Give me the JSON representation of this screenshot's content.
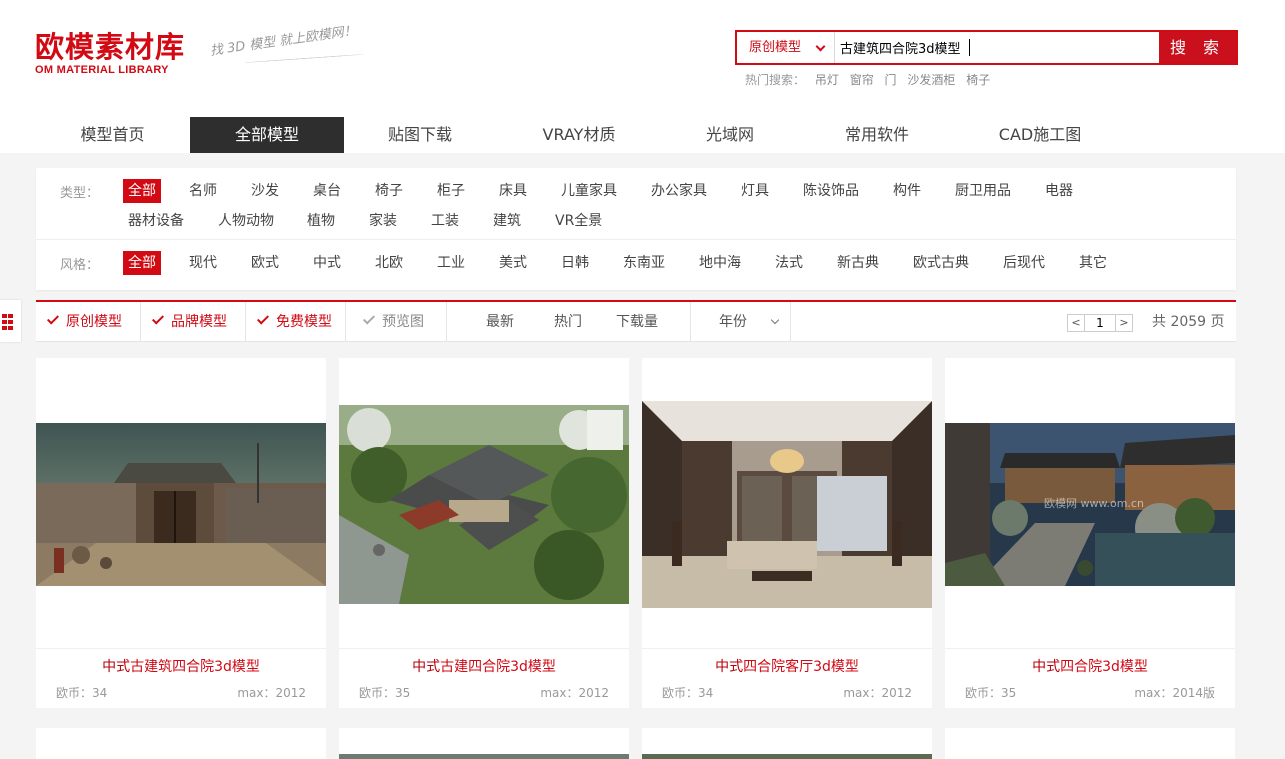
{
  "brand": {
    "logo_main": "欧模素材库",
    "logo_sub": "OM MATERIAL LIBRARY",
    "slogan": "找 3D 模型 就上欧模网！",
    "accent": "#d10a14"
  },
  "search": {
    "type": "原创模型",
    "value": "古建筑四合院3d模型",
    "button": "搜 索"
  },
  "hot": {
    "label": "热门搜索：",
    "items": [
      "吊灯",
      "窗帘",
      "门",
      "沙发酒柜",
      "椅子"
    ]
  },
  "nav": [
    "模型首页",
    "全部模型",
    "贴图下载",
    "VRAY材质",
    "光域网",
    "常用软件",
    "CAD施工图"
  ],
  "filters": {
    "type_label": "类型：",
    "types": [
      "全部",
      "名师",
      "沙发",
      "桌台",
      "椅子",
      "柜子",
      "床具",
      "儿童家具",
      "办公家具",
      "灯具",
      "陈设饰品",
      "构件",
      "厨卫用品",
      "电器",
      "器材设备",
      "人物动物",
      "植物",
      "家装",
      "工装",
      "建筑",
      "VR全景"
    ],
    "style_label": "风格：",
    "styles": [
      "全部",
      "现代",
      "欧式",
      "中式",
      "北欧",
      "工业",
      "美式",
      "日韩",
      "东南亚",
      "地中海",
      "法式",
      "新古典",
      "欧式古典",
      "后现代",
      "其它"
    ]
  },
  "sortbar": {
    "checks": [
      "原创模型",
      "品牌模型",
      "免费模型",
      "预览图"
    ],
    "sorts": [
      "最新",
      "热门",
      "下载量"
    ],
    "year": "年份",
    "page": "1",
    "prev": "<",
    "next": ">",
    "total": "共 2059 页"
  },
  "cards": [
    {
      "title_pre": "中式",
      "title": "古建筑四合院3d模型",
      "coin": "欧币：34",
      "max": "max：2012"
    },
    {
      "title_pre": "中式",
      "title": "古建四合院3d模型",
      "coin": "欧币：35",
      "max": "max：2012"
    },
    {
      "title_pre": "中式",
      "title": "四合院客厅3d模型",
      "coin": "欧币：34",
      "max": "max：2012"
    },
    {
      "title_pre": "中式",
      "title": "四合院3d模型",
      "coin": "欧币：35",
      "max": "max：2014版"
    }
  ],
  "watermark": "欧模网 www.om.cn"
}
